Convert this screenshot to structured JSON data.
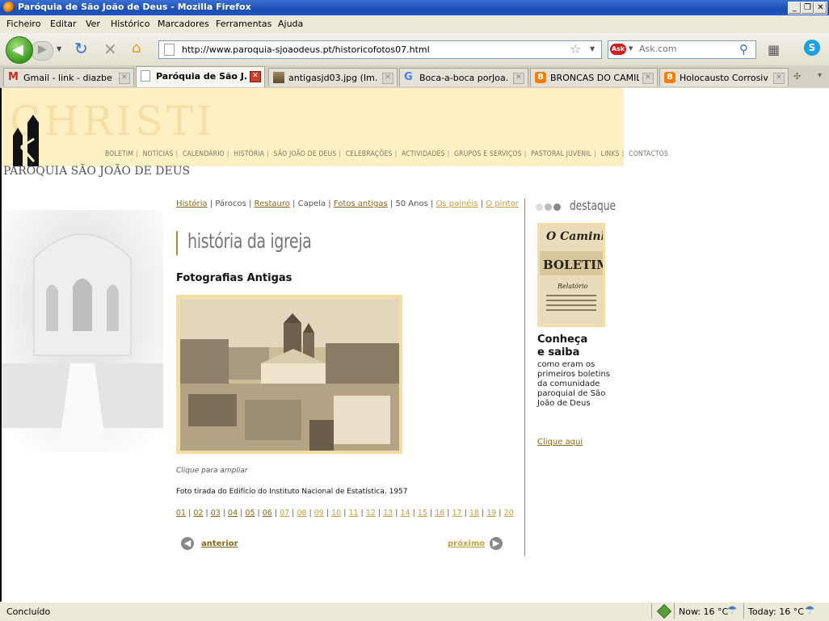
{
  "window": {
    "title": "Paróquia de São João de Deus - Mozilla Firefox"
  },
  "menu": [
    "Ficheiro",
    "Editar",
    "Ver",
    "Histórico",
    "Marcadores",
    "Ferramentas",
    "Ajuda"
  ],
  "toolbar": {
    "url": "http://www.paroquia-sjoaodeus.pt/historicofotos07.html",
    "search_placeholder": "Ask.com"
  },
  "tabs": [
    {
      "label": "Gmail - link - diazber...",
      "icon": "gmail-icon"
    },
    {
      "label": "Paróquia de São J...",
      "icon": "page-icon",
      "active": true
    },
    {
      "label": "antigasjd03.jpg (Im...",
      "icon": "image-icon"
    },
    {
      "label": "Boca-a-boca porJoa...",
      "icon": "google-icon"
    },
    {
      "label": "BRONCAS DO CAMILO",
      "icon": "blogger-icon"
    },
    {
      "label": "Holocausto Corrosiv...",
      "icon": "blogger-icon"
    }
  ],
  "site": {
    "header_word": "CHRISTI",
    "logo_text": "PARÓQUIA SÃO JOÃO DE DEUS",
    "nav": [
      "BOLETIM",
      "NOTÍCIAS",
      "CALENDÁRIO",
      "HISTÓRIA",
      "SÃO JOÃO DE DEUS",
      "CELEBRAÇÕES",
      "ACTIVIDADES",
      "GRUPOS E SERVIÇOS",
      "PASTORAL JUVENIL",
      "LINKS",
      "CONTACTOS"
    ]
  },
  "breadcrumbs": [
    {
      "label": "História",
      "link": true
    },
    {
      "label": "Párocos",
      "link": false
    },
    {
      "label": "Restauro",
      "link": true
    },
    {
      "label": "Capela",
      "link": false
    },
    {
      "label": "Fotos antigas",
      "link": true
    },
    {
      "label": "50 Anos",
      "link": false
    },
    {
      "label": "Os painéis",
      "link": true,
      "light": true
    },
    {
      "label": "O pintor",
      "link": true,
      "light": true
    }
  ],
  "main": {
    "section_title": "história da igreja",
    "heading": "Fotografias Antigas",
    "click_hint": "Clique para ampliar",
    "caption": "Foto tirada do Edifício do Instituto Nacional de Estatística. 1957",
    "pages": [
      "01",
      "02",
      "03",
      "04",
      "05",
      "06",
      "07",
      "08",
      "09",
      "10",
      "11",
      "12",
      "13",
      "14",
      "15",
      "16",
      "17",
      "18",
      "19",
      "20"
    ],
    "dark_pages": 6,
    "prev": "anterior",
    "next": "próximo"
  },
  "sidebar": {
    "title": "destaque",
    "heading_line1": "Conheça",
    "heading_line2": "e saiba",
    "text": "como eram os primeiros boletins da comunidade paroquial de São João de Deus",
    "link": "Clique aqui",
    "image_text_1": "O Caminho",
    "image_text_2": "BOLETIM",
    "image_text_3": "Relatório"
  },
  "status": {
    "text": "Concluído",
    "now": "Now: 16 °C",
    "today": "Today: 16 °C"
  },
  "colors": {
    "accent": "#8a6a16",
    "header_bg": "#fff0c4",
    "link_light": "#c8a040"
  }
}
